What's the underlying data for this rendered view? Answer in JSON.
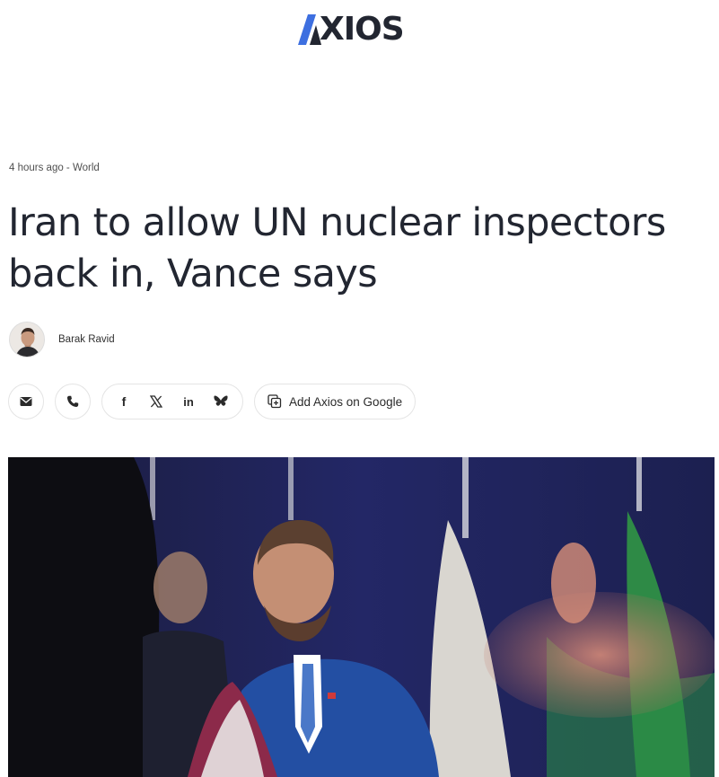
{
  "header": {
    "logo_text": "XIOS",
    "logo_full": "AXIOS",
    "colors": {
      "logo_blue": "#3d6fe0",
      "logo_dark": "#222631"
    }
  },
  "article": {
    "meta": "4 hours ago - World",
    "headline": "Iran to allow UN nuclear inspectors back in, Vance says",
    "author": "Barak Ravid"
  },
  "share": {
    "email_icon": "email-icon",
    "phone_icon": "phone-icon",
    "facebook_label": "f",
    "x_label": "𝕏",
    "linkedin_label": "in",
    "bluesky_icon": "bluesky-icon",
    "google_label": "Add Axios on Google"
  },
  "hero": {
    "icon": "photo"
  }
}
